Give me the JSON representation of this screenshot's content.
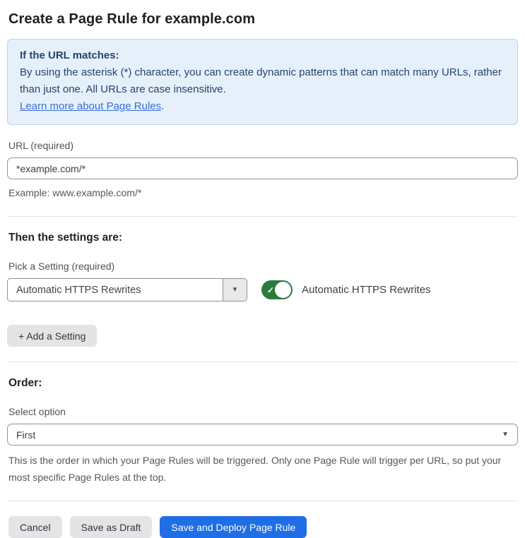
{
  "page": {
    "title": "Create a Page Rule for example.com"
  },
  "info_box": {
    "heading": "If the URL matches:",
    "body": "By using the asterisk (*) character, you can create dynamic patterns that can match many URLs, rather than just one. All URLs are case insensitive.",
    "link_label": "Learn more about Page Rules",
    "link_suffix": "."
  },
  "url_field": {
    "label": "URL (required)",
    "value": "*example.com/*",
    "helper": "Example: www.example.com/*"
  },
  "settings_section": {
    "heading": "Then the settings are:",
    "picker_label": "Pick a Setting (required)",
    "picker_value": "Automatic HTTPS Rewrites",
    "picker_arrow": "▼",
    "toggle_state": "on",
    "toggle_check": "✓",
    "toggle_label": "Automatic HTTPS Rewrites",
    "add_setting_label": "+ Add a Setting"
  },
  "order_section": {
    "heading": "Order:",
    "select_label": "Select option",
    "select_value": "First",
    "select_arrow": "▼",
    "helper": "This is the order in which your Page Rules will be triggered. Only one Page Rule will trigger per URL, so put your most specific Page Rules at the top."
  },
  "footer": {
    "cancel_label": "Cancel",
    "save_draft_label": "Save as Draft",
    "save_deploy_label": "Save and Deploy Page Rule"
  },
  "colors": {
    "info_background": "#e6f0fb",
    "info_border": "#b9d4f0",
    "info_text": "#27426f",
    "link_blue": "#3a6fd8",
    "toggle_green": "#2b7b3f",
    "primary_button_blue": "#1f6ee5",
    "secondary_button_gray": "#e4e4e6"
  }
}
